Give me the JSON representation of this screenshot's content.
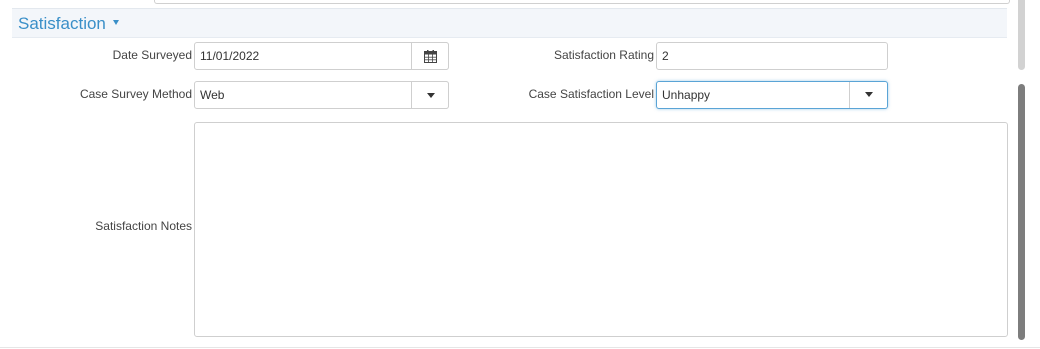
{
  "section": {
    "title": "Satisfaction"
  },
  "fields": {
    "date_surveyed": {
      "label": "Date Surveyed",
      "value": "11/01/2022"
    },
    "satisfaction_rating": {
      "label": "Satisfaction Rating",
      "value": "2"
    },
    "case_survey_method": {
      "label": "Case Survey Method",
      "value": "Web"
    },
    "case_satisfaction_level": {
      "label": "Case Satisfaction Level",
      "value": "Unhappy"
    },
    "satisfaction_notes": {
      "label": "Satisfaction Notes",
      "value": ""
    }
  },
  "icons": {
    "section_toggle": "caret-down-icon",
    "date_picker": "calendar-icon",
    "dropdown": "triangle-down-icon"
  },
  "colors": {
    "accent": "#3a8fc8",
    "focus_border": "#5aa4d6",
    "header_bg": "#f3f6fa"
  }
}
